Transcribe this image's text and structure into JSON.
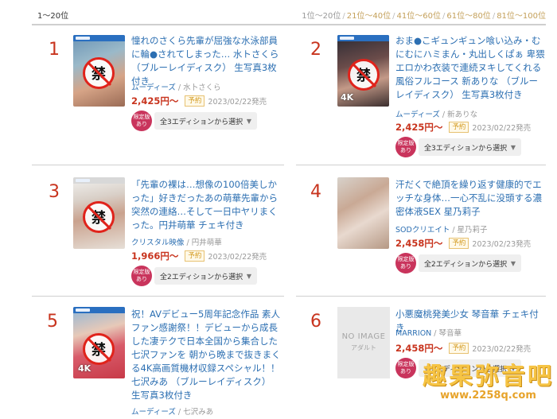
{
  "header": {
    "range": "1〜20位",
    "pages": [
      {
        "label": "1位〜20位",
        "current": true
      },
      {
        "label": "21位〜40位",
        "current": false
      },
      {
        "label": "41位〜60位",
        "current": false
      },
      {
        "label": "61位〜80位",
        "current": false
      },
      {
        "label": "81位〜100位",
        "current": false
      }
    ],
    "sep": "/"
  },
  "items": [
    {
      "rank": "1",
      "title": "憧れのさくら先輩が屈強な水泳部員に輪●されてしまった… 水トさくら （ブルーレイディスク） 生写真3枚付き",
      "maker": "ムーディーズ",
      "actress": "水卜さくら",
      "price": "2,425円〜",
      "preorder": "予約",
      "release": "2023/02/22発売",
      "limited": "限定版あり",
      "edition": "全3エディションから選択",
      "banned": "禁"
    },
    {
      "rank": "2",
      "title": "おま●こギュンギュン喰い込み・むにむにハミまん・丸出しくぱぁ 卑猥エロかわ衣装で連続ヌキしてくれる風俗フルコース 新ありな （ブルーレイディスク） 生写真3枚付き",
      "maker": "ムーディーズ",
      "actress": "新ありな",
      "price": "2,425円〜",
      "preorder": "予約",
      "release": "2023/02/22発売",
      "limited": "限定版あり",
      "edition": "全3エディションから選択",
      "banned": "禁",
      "badge": "4K"
    },
    {
      "rank": "3",
      "title": "「先輩の裸は…想像の100倍美しかった」好きだったあの萌華先輩から突然の連絡…そして一日中ヤリまくった。円井萌華 チェキ付き",
      "maker": "クリスタル映像",
      "actress": "円井萌華",
      "price": "1,966円〜",
      "preorder": "予約",
      "release": "2023/02/22発売",
      "limited": "限定版あり",
      "edition": "全2エディションから選択",
      "banned": "禁"
    },
    {
      "rank": "4",
      "title": "汗だくで絶頂を繰り返す健康的でエッチな身体…一心不乱に没頭する濃密体液SEX 星乃莉子",
      "maker": "SODクリエイト",
      "actress": "星乃莉子",
      "price": "2,458円〜",
      "preorder": "予約",
      "release": "2023/02/23発売",
      "limited": "限定版あり",
      "edition": "全2エディションから選択"
    },
    {
      "rank": "5",
      "title": "祝！AVデビュー5周年記念作品 素人ファン感謝祭！！デビューから成長した凄テクで日本全国から集合した七沢ファンを 朝から晩まで抜きまくる4K高画質機材収録スペシャル！！ 七沢みあ （ブルーレイディスク） 生写真3枚付き",
      "maker": "ムーディーズ",
      "actress": "七沢みあ",
      "banned": "禁",
      "badge": "4K"
    },
    {
      "rank": "6",
      "title": "小悪魔桃発美少女 琴音華 チェキ付き",
      "maker": "MARRION",
      "actress": "琴音華",
      "price": "2,458円〜",
      "preorder": "予約",
      "release": "2023/02/22発売",
      "limited": "限定版あり",
      "edition": "全2エディションから選択",
      "noimage": "NO IMAGE",
      "noimage_sub": "アダルト"
    }
  ],
  "watermark": {
    "text": "趣果弥音吧",
    "url": "www.2258q.com"
  },
  "colors": {
    "rank": "#c8341e",
    "link": "#2c6fb2",
    "price": "#c8341e",
    "limited_badge": "#c9345c",
    "banned_ring": "#e0231b"
  }
}
